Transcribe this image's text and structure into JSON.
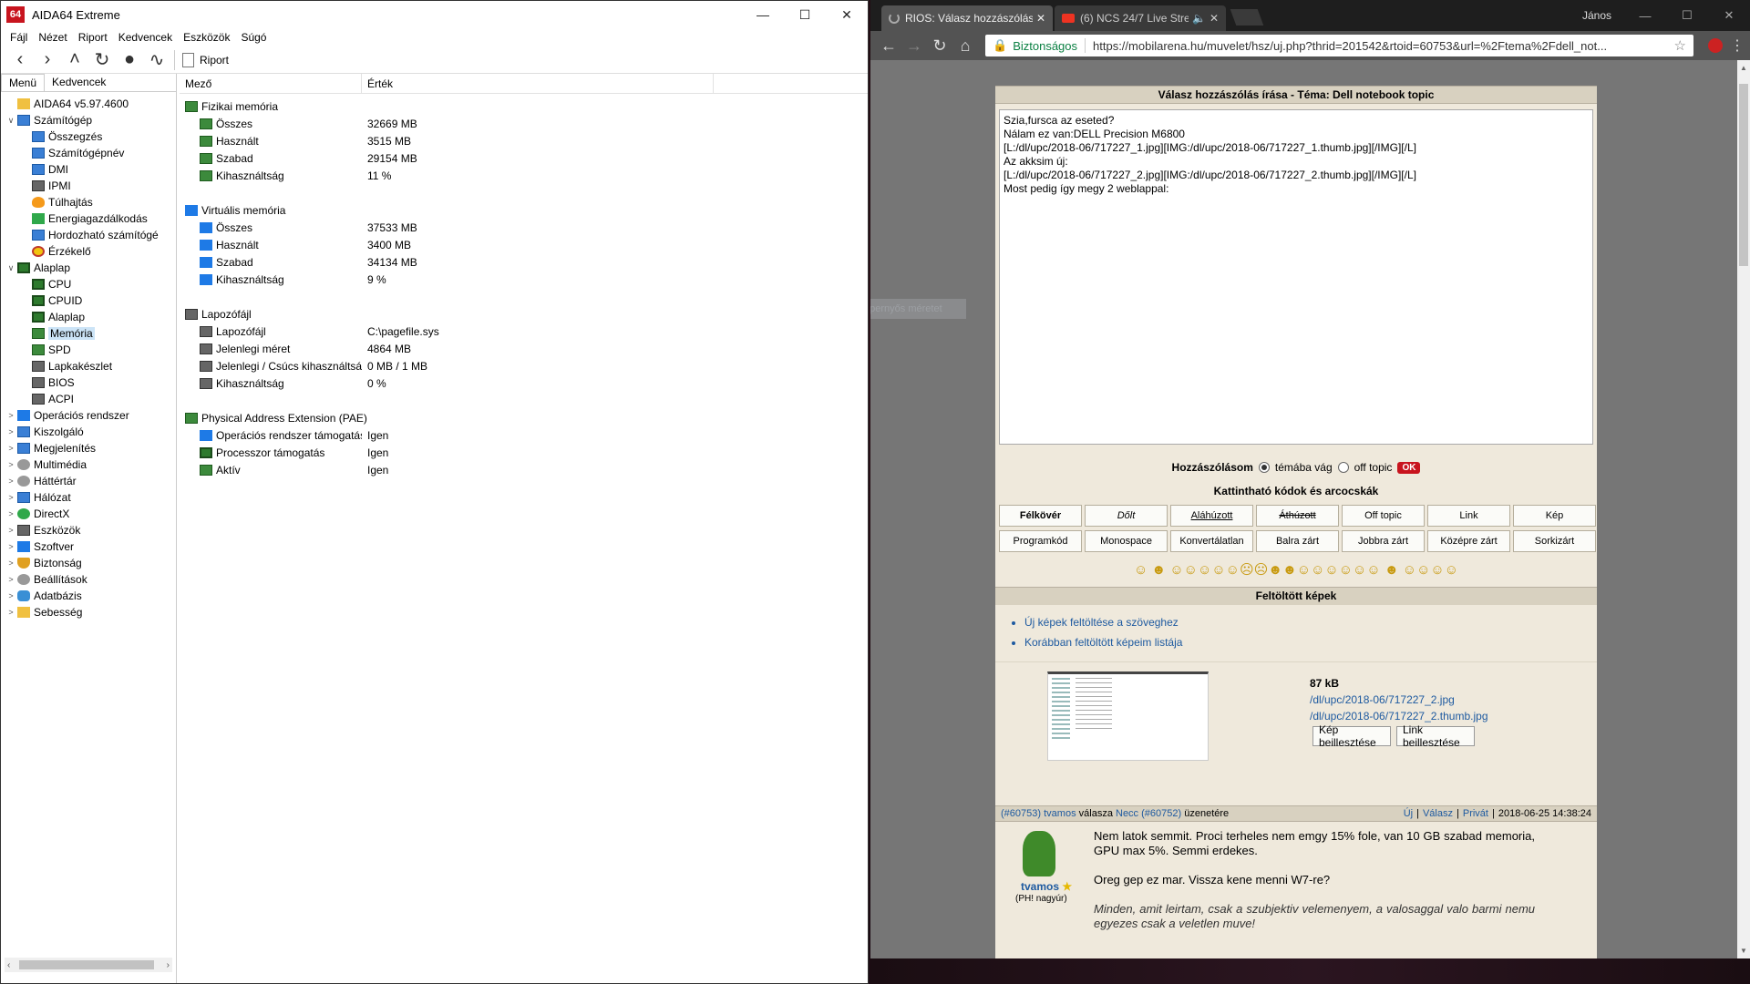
{
  "aida": {
    "title": "AIDA64 Extreme",
    "menu": [
      "Fájl",
      "Nézet",
      "Riport",
      "Kedvencek",
      "Eszközök",
      "Súgó"
    ],
    "toolbar_report": "Riport",
    "tabs": [
      "Menü",
      "Kedvencek"
    ],
    "tree": [
      {
        "label": "AIDA64 v5.97.4600",
        "exp": "",
        "indent": 0,
        "icon": "ic-folder",
        "name": "aida64-version"
      },
      {
        "label": "Számítógép",
        "exp": "∨",
        "indent": 0,
        "icon": "ic-mon",
        "name": "computer"
      },
      {
        "label": "Összegzés",
        "exp": "",
        "indent": 1,
        "icon": "ic-mon",
        "name": "summary"
      },
      {
        "label": "Számítógépnév",
        "exp": "",
        "indent": 1,
        "icon": "ic-mon",
        "name": "computer-name"
      },
      {
        "label": "DMI",
        "exp": "",
        "indent": 1,
        "icon": "ic-mon",
        "name": "dmi"
      },
      {
        "label": "IPMI",
        "exp": "",
        "indent": 1,
        "icon": "ic-chip",
        "name": "ipmi"
      },
      {
        "label": "Túlhajtás",
        "exp": "",
        "indent": 1,
        "icon": "ic-fire",
        "name": "overclock"
      },
      {
        "label": "Energiagazdálkodás",
        "exp": "",
        "indent": 1,
        "icon": "ic-pow",
        "name": "power-management"
      },
      {
        "label": "Hordozható számítógé",
        "exp": "",
        "indent": 1,
        "icon": "ic-mon",
        "name": "portable-computer"
      },
      {
        "label": "Érzékelő",
        "exp": "",
        "indent": 1,
        "icon": "ic-gauge",
        "name": "sensor"
      },
      {
        "label": "Alaplap",
        "exp": "∨",
        "indent": 0,
        "icon": "ic-board",
        "name": "motherboard-group"
      },
      {
        "label": "CPU",
        "exp": "",
        "indent": 1,
        "icon": "ic-board",
        "name": "cpu"
      },
      {
        "label": "CPUID",
        "exp": "",
        "indent": 1,
        "icon": "ic-board",
        "name": "cpuid"
      },
      {
        "label": "Alaplap",
        "exp": "",
        "indent": 1,
        "icon": "ic-board",
        "name": "motherboard"
      },
      {
        "label": "Memória",
        "exp": "",
        "indent": 1,
        "icon": "ic-ram",
        "name": "memory",
        "selected": true
      },
      {
        "label": "SPD",
        "exp": "",
        "indent": 1,
        "icon": "ic-ram",
        "name": "spd"
      },
      {
        "label": "Lapkakészlet",
        "exp": "",
        "indent": 1,
        "icon": "ic-chip",
        "name": "chipset"
      },
      {
        "label": "BIOS",
        "exp": "",
        "indent": 1,
        "icon": "ic-chip",
        "name": "bios"
      },
      {
        "label": "ACPI",
        "exp": "",
        "indent": 1,
        "icon": "ic-chip",
        "name": "acpi"
      },
      {
        "label": "Operációs rendszer",
        "exp": ">",
        "indent": 0,
        "icon": "ic-win",
        "name": "operating-system"
      },
      {
        "label": "Kiszolgáló",
        "exp": ">",
        "indent": 0,
        "icon": "ic-mon",
        "name": "server"
      },
      {
        "label": "Megjelenítés",
        "exp": ">",
        "indent": 0,
        "icon": "ic-mon",
        "name": "display"
      },
      {
        "label": "Multimédia",
        "exp": ">",
        "indent": 0,
        "icon": "ic-gear",
        "name": "multimedia"
      },
      {
        "label": "Háttértár",
        "exp": ">",
        "indent": 0,
        "icon": "ic-gear",
        "name": "storage"
      },
      {
        "label": "Hálózat",
        "exp": ">",
        "indent": 0,
        "icon": "ic-mon",
        "name": "network"
      },
      {
        "label": "DirectX",
        "exp": ">",
        "indent": 0,
        "icon": "ic-x",
        "name": "directx"
      },
      {
        "label": "Eszközök",
        "exp": ">",
        "indent": 0,
        "icon": "ic-chip",
        "name": "devices"
      },
      {
        "label": "Szoftver",
        "exp": ">",
        "indent": 0,
        "icon": "ic-win",
        "name": "software"
      },
      {
        "label": "Biztonság",
        "exp": ">",
        "indent": 0,
        "icon": "ic-shield",
        "name": "security"
      },
      {
        "label": "Beállítások",
        "exp": ">",
        "indent": 0,
        "icon": "ic-gear",
        "name": "settings"
      },
      {
        "label": "Adatbázis",
        "exp": ">",
        "indent": 0,
        "icon": "ic-db",
        "name": "database"
      },
      {
        "label": "Sebesség",
        "exp": ">",
        "indent": 0,
        "icon": "ic-folder",
        "name": "speed"
      }
    ],
    "columns": [
      "Mező",
      "Érték"
    ],
    "groups": [
      {
        "title": "Fizikai memória",
        "icon": "ic-ram",
        "rows": [
          {
            "field": "Összes",
            "value": "32669 MB",
            "icon": "ic-ram"
          },
          {
            "field": "Használt",
            "value": "3515 MB",
            "icon": "ic-ram"
          },
          {
            "field": "Szabad",
            "value": "29154 MB",
            "icon": "ic-ram"
          },
          {
            "field": "Kihasználtság",
            "value": "11 %",
            "icon": "ic-ram"
          }
        ]
      },
      {
        "title": "Virtuális memória",
        "icon": "ic-win",
        "rows": [
          {
            "field": "Összes",
            "value": "37533 MB",
            "icon": "ic-win"
          },
          {
            "field": "Használt",
            "value": "3400 MB",
            "icon": "ic-win"
          },
          {
            "field": "Szabad",
            "value": "34134 MB",
            "icon": "ic-win"
          },
          {
            "field": "Kihasználtság",
            "value": "9 %",
            "icon": "ic-win"
          }
        ]
      },
      {
        "title": "Lapozófájl",
        "icon": "ic-chip",
        "rows": [
          {
            "field": "Lapozófájl",
            "value": "C:\\pagefile.sys",
            "icon": "ic-chip"
          },
          {
            "field": "Jelenlegi méret",
            "value": "4864 MB",
            "icon": "ic-chip"
          },
          {
            "field": "Jelenlegi / Csúcs kihasználtság",
            "value": "0 MB / 1 MB",
            "icon": "ic-chip"
          },
          {
            "field": "Kihasználtság",
            "value": "0 %",
            "icon": "ic-chip"
          }
        ]
      },
      {
        "title": "Physical Address Extension (PAE)",
        "icon": "ic-ram",
        "rows": [
          {
            "field": "Operációs rendszer támogatás",
            "value": "Igen",
            "icon": "ic-win"
          },
          {
            "field": "Processzor támogatás",
            "value": "Igen",
            "icon": "ic-board"
          },
          {
            "field": "Aktív",
            "value": "Igen",
            "icon": "ic-ram"
          }
        ]
      }
    ]
  },
  "browser": {
    "tabs": [
      {
        "title": "RIOS: Válasz hozzászólás",
        "active": true
      },
      {
        "title": "(6) NCS 24/7 Live Strea",
        "active": false
      }
    ],
    "user": "János",
    "secure_label": "Biztonságos",
    "url": "https://mobilarena.hu/muvelet/hsz/uj.php?thrid=201542&rtoid=60753&url=%2Ftema%2Fdell_not...",
    "ghost_text": "Teljes képernyős méretet",
    "forum": {
      "title": "Válasz hozzászólás írása - Téma: Dell notebook topic",
      "textarea": "Szia,fursca az eseted?\nNálam ez van:DELL Precision M6800\n[L:/dl/upc/2018-06/717227_1.jpg][IMG:/dl/upc/2018-06/717227_1.thumb.jpg][/IMG][/L]\nAz akksim új:\n[L:/dl/upc/2018-06/717227_2.jpg][IMG:/dl/upc/2018-06/717227_2.thumb.jpg][/IMG][/L]\nMost pedig így megy 2 weblappal:",
      "post_label": "Hozzászólásom",
      "radio_on": "témába vág",
      "radio_off": "off topic",
      "ok": "OK",
      "codes_title": "Kattintható kódok és arcocskák",
      "codes": [
        {
          "label": "Félkövér",
          "style": "bold"
        },
        {
          "label": "Dőlt",
          "style": "it"
        },
        {
          "label": "Aláhúzott",
          "style": "ul"
        },
        {
          "label": "Áthúzott",
          "style": "st"
        },
        {
          "label": "Off topic",
          "style": ""
        },
        {
          "label": "Link",
          "style": ""
        },
        {
          "label": "Kép",
          "style": ""
        },
        {
          "label": "Programkód",
          "style": ""
        },
        {
          "label": "Monospace",
          "style": ""
        },
        {
          "label": "Konvertálatlan",
          "style": ""
        },
        {
          "label": "Balra zárt",
          "style": ""
        },
        {
          "label": "Jobbra zárt",
          "style": ""
        },
        {
          "label": "Középre zárt",
          "style": ""
        },
        {
          "label": "Sorkizárt",
          "style": ""
        }
      ],
      "smileys": "☺  ☻ ☺☺☺☺☺☹☹☻☻☺☺☺☺☺☺ ☻ ☺☺☺☺",
      "uploads_title": "Feltöltött képek",
      "upload_links": [
        "Új képek feltöltése a szöveghez",
        "Korábban feltöltött képeim listája"
      ],
      "upload_size": "87 kB",
      "upload_path1": "/dl/upc/2018-06/717227_2.jpg",
      "upload_path2": "/dl/upc/2018-06/717227_2.thumb.jpg",
      "insert_image": "Kép beillesztése",
      "insert_link": "Link beillesztése",
      "post": {
        "id": "(#60753)",
        "user": "tvamos",
        "reply_word": "válasza",
        "reply_to": "Necc",
        "reply_id": "(#60752)",
        "reply_suffix": "üzenetére",
        "actions": [
          "Új",
          "Válasz",
          "Privát"
        ],
        "date": "2018-06-25 14:38:24",
        "username": "tvamos",
        "rank": "(PH! nagyúr)",
        "para1": "Nem latok semmit. Proci terheles nem emgy 15% fole, van 10 GB szabad memoria, GPU max 5%. Semmi erdekes.",
        "para2": "Oreg gep ez mar. Vissza kene menni W7-re?",
        "signature": "Minden, amit leirtam, csak a szubjektiv velemenyem, a valosaggal valo barmi nemu egyezes csak a veletlen muve!"
      }
    }
  }
}
